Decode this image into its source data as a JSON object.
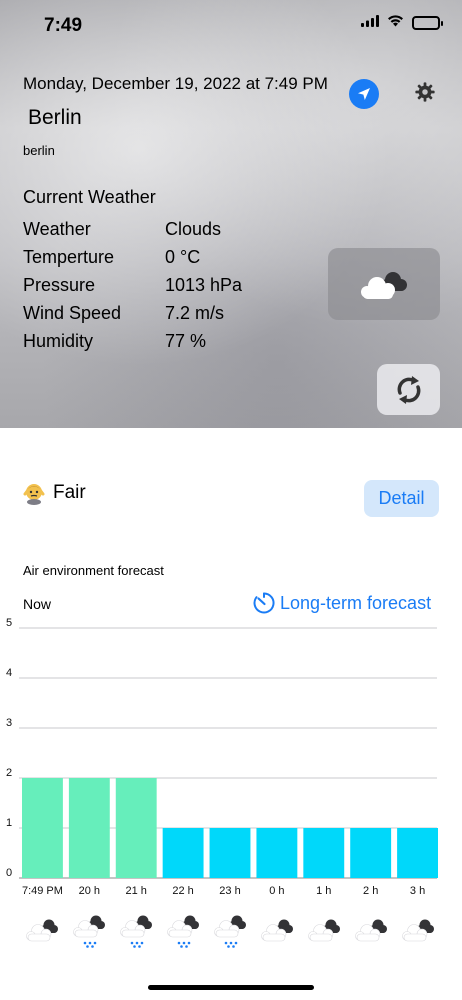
{
  "status_bar": {
    "time": "7:49"
  },
  "header": {
    "date": "Monday, December 19, 2022 at 7:49 PM",
    "city": "Berlin",
    "city_sub": "berlin"
  },
  "current": {
    "title": "Current Weather",
    "rows": [
      {
        "label": "Weather",
        "value": "Clouds"
      },
      {
        "label": "Temperture",
        "value": "0 °C"
      },
      {
        "label": "Pressure",
        "value": "1013 hPa"
      },
      {
        "label": "Wind Speed",
        "value": "7.2 m/s"
      },
      {
        "label": "Humidity",
        "value": "77 %"
      }
    ]
  },
  "icons": {
    "location": "location-arrow-icon",
    "settings": "gear-icon",
    "weather": "clouds-icon",
    "refresh": "refresh-icon",
    "air_status": "face-emoji-icon",
    "long_term": "timer-icon"
  },
  "air": {
    "status": "Fair",
    "detail_label": "Detail",
    "forecast_label": "Air environment forecast",
    "now_label": "Now",
    "long_term_label": "Long-term forecast"
  },
  "colors": {
    "accent": "#1a7cf5",
    "bar_green": "#66eebb",
    "bar_cyan": "#00d8fa",
    "detail_bg": "#d4e7fb"
  },
  "chart_data": {
    "type": "bar",
    "categories": [
      "7:49 PM",
      "20 h",
      "21 h",
      "22 h",
      "23 h",
      "0 h",
      "1 h",
      "2 h",
      "3 h"
    ],
    "values": [
      2,
      2,
      2,
      1,
      1,
      1,
      1,
      1,
      1
    ],
    "ylim": [
      0,
      5
    ],
    "yticks": [
      "0",
      "1",
      "2",
      "3",
      "4",
      "5"
    ],
    "grid": true,
    "bar_colors": [
      "#66eebb",
      "#66eebb",
      "#66eebb",
      "#00d8fa",
      "#00d8fa",
      "#00d8fa",
      "#00d8fa",
      "#00d8fa",
      "#00d8fa"
    ]
  },
  "hourly_icons": [
    "cloud-icon",
    "rain-icon",
    "rain-icon",
    "rain-icon",
    "rain-icon",
    "cloud-icon",
    "cloud-icon",
    "cloud-icon",
    "cloud-icon"
  ]
}
